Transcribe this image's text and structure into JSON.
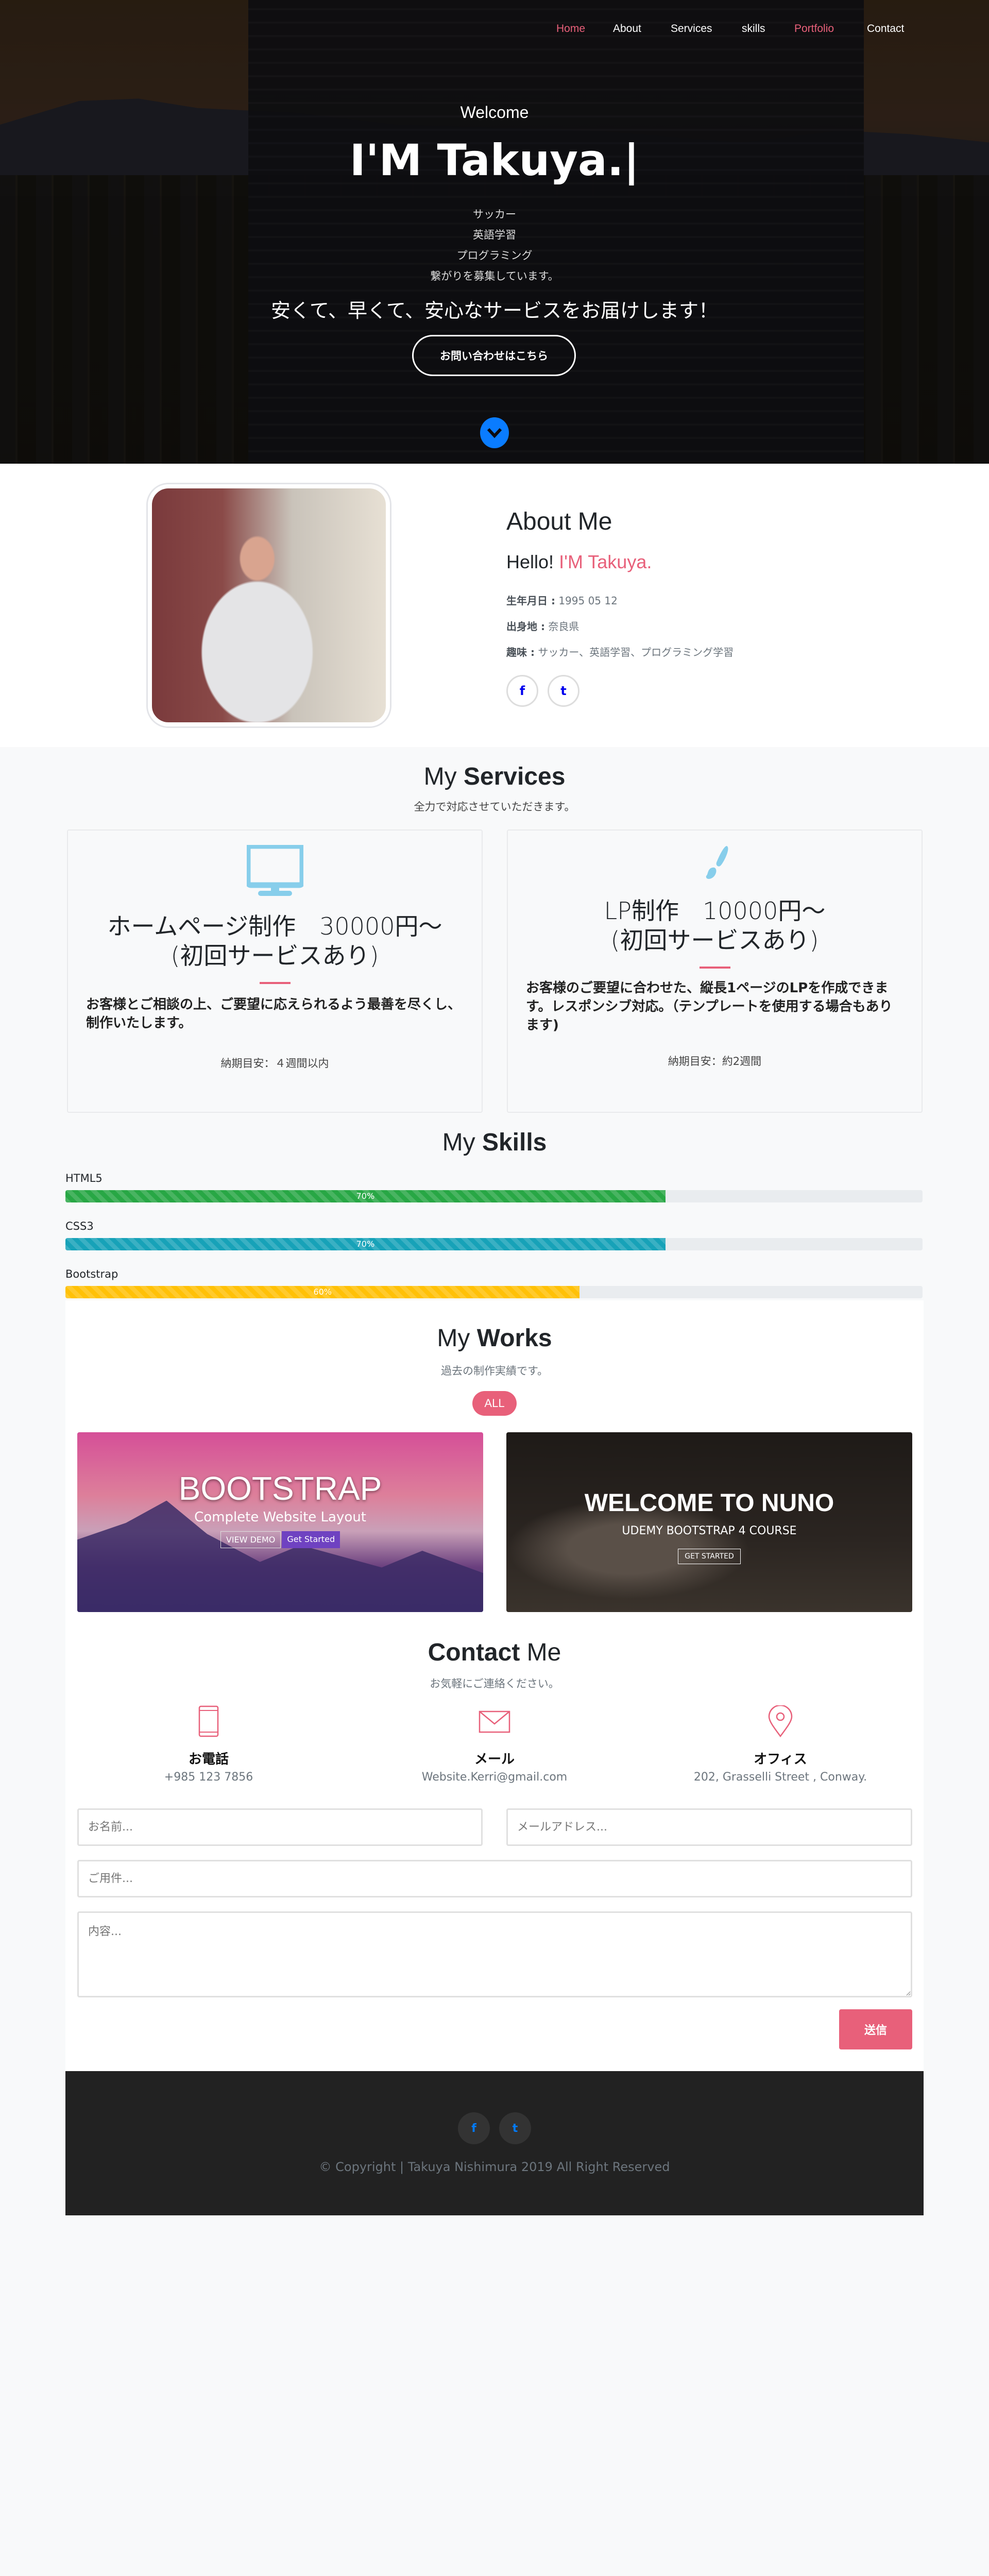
{
  "nav": {
    "items": [
      {
        "label": "Home",
        "active": true
      },
      {
        "label": "About"
      },
      {
        "label": "Services"
      },
      {
        "label": "skills"
      },
      {
        "label": "Portfolio",
        "active": true
      },
      {
        "label": "Contact"
      }
    ]
  },
  "hero": {
    "welcome": "Welcome",
    "title": "I'M Takuya.|",
    "lines": [
      "サッカー",
      "英語学習",
      "プログラミング",
      "繋がりを募集しています。"
    ],
    "tagline": "安くて、早くて、安心なサービスをお届けします！",
    "cta": "お問い合わせはこちら",
    "scroll_icon": "chevron-down-icon"
  },
  "about": {
    "title_light": "About",
    "title_bold": "Me",
    "hello": "Hello!",
    "name": "I'M Takuya.",
    "birthday_label": "生年月日 :",
    "birthday": "1995 05 12",
    "origin_label": "出身地 :",
    "origin": "奈良県",
    "hobby_label": "趣味 :",
    "hobby": "サッカー、英語学習、プログラミング学習",
    "social": [
      "f",
      "t"
    ]
  },
  "services": {
    "title_light": "My",
    "title_bold": "Services",
    "subtitle": "全力で対応させていただきます。",
    "cards": [
      {
        "icon": "monitor-icon",
        "title1": "ホームページ制作　30000円〜",
        "title2": "(初回サービスあり)",
        "desc": "お客様とご相談の上、ご要望に応えられるよう最善を尽くし、制作いたします。",
        "eta": "納期目安：４週間以内"
      },
      {
        "icon": "paint-brush-icon",
        "title1": "LP制作　10000円〜",
        "title2": "(初回サービスあり)",
        "desc": "お客様のご要望に合わせた、縦長1ページのLPを作成できます。レスポンシブ対応。（テンプレートを使用する場合もあります)",
        "eta": "納期目安：約2週間"
      }
    ]
  },
  "skills": {
    "title_light": "My",
    "title_bold": "Skills",
    "items": [
      {
        "name": "HTML5",
        "percent": 70,
        "label": "70%",
        "color": "#28a745"
      },
      {
        "name": "CSS3",
        "percent": 70,
        "label": "70%",
        "color": "#17a2b8"
      },
      {
        "name": "Bootstrap",
        "percent": 60,
        "label": "60%",
        "color": "#ffc107"
      }
    ]
  },
  "works": {
    "title_light": "My",
    "title_bold": "Works",
    "subtitle": "過去の制作実績です。",
    "filter": "ALL",
    "items": [
      {
        "heading": "BOOTSTRAP",
        "sub": "Complete Website Layout",
        "btn1": "VIEW DEMO",
        "btn2": "Get Started"
      },
      {
        "heading": "WELCOME TO NUNO",
        "sub": "UDEMY BOOTSTRAP 4 COURSE",
        "btn1": "GET STARTED"
      }
    ]
  },
  "contact": {
    "title_light": "Contact",
    "title_bold": "Me",
    "subtitle": "お気軽にご連絡ください。",
    "items": [
      {
        "icon": "phone-icon",
        "label": "お電話",
        "value": "+985 123 7856"
      },
      {
        "icon": "envelope-icon",
        "label": "メール",
        "value": "Website.Kerri@gmail.com"
      },
      {
        "icon": "map-pin-icon",
        "label": "オフィス",
        "value": "202, Grasselli Street , Conway."
      }
    ],
    "form": {
      "name_ph": "お名前...",
      "email_ph": "メールアドレス...",
      "subject_ph": "ご用件...",
      "message_ph": "内容...",
      "submit": "送信"
    }
  },
  "footer": {
    "social": [
      "f",
      "t"
    ],
    "copyright": "© Copyright | Takuya Nishimura 2019 All Right Reserved"
  },
  "colors": {
    "accent": "#e8607a",
    "footer_bg": "#222222",
    "icon_blue": "#87ceeb"
  }
}
